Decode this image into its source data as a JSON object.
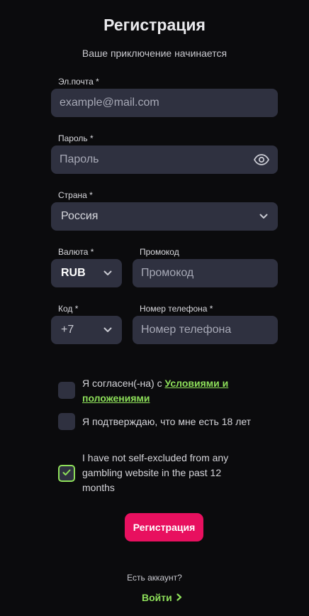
{
  "header": {
    "title": "Регистрация",
    "subtitle": "Ваше приключение начинается"
  },
  "form": {
    "email": {
      "label": "Эл.почта *",
      "placeholder": "example@mail.com",
      "value": ""
    },
    "password": {
      "label": "Пароль *",
      "placeholder": "Пароль",
      "value": "",
      "toggle_icon": "eye-icon"
    },
    "country": {
      "label": "Страна *",
      "value": "Россия"
    },
    "currency": {
      "label": "Валюта *",
      "value": "RUB"
    },
    "promo": {
      "label": "Промокод",
      "placeholder": "Промокод",
      "value": ""
    },
    "phone_code": {
      "label": "Код *",
      "value": "+7"
    },
    "phone": {
      "label": "Номер телефона *",
      "placeholder": "Номер телефона",
      "value": ""
    }
  },
  "checkboxes": {
    "terms": {
      "prefix": "Я согласен(-на) с ",
      "link": "Условиями и положениями",
      "checked": false
    },
    "age": {
      "text": "Я подтверждаю, что мне есть 18 лет",
      "checked": false
    },
    "self_excluded": {
      "text": "I have not self-excluded from any gambling website in the past 12 months",
      "checked": true
    }
  },
  "actions": {
    "submit_label": "Регистрация",
    "have_account": "Есть аккаунт?",
    "login_label": "Войти"
  },
  "colors": {
    "background": "#0b0b0d",
    "field": "#2f3140",
    "accent_pink": "#e8105f",
    "accent_green": "#8ee05a"
  }
}
